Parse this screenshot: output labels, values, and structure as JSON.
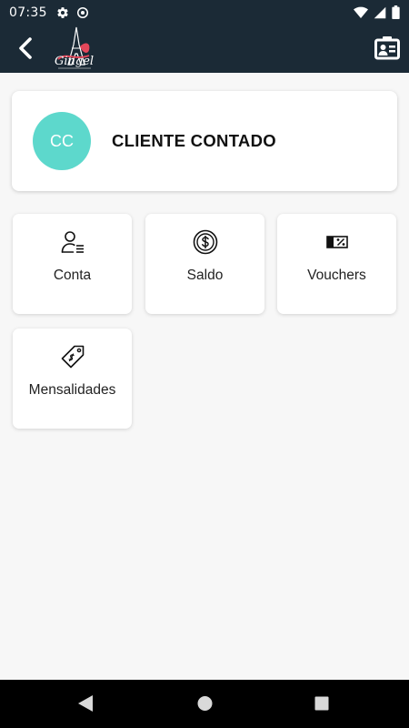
{
  "status_bar": {
    "time": "07:35",
    "left_icons": [
      "settings-icon",
      "sync-icon"
    ],
    "right_icons": [
      "wifi-icon",
      "signal-icon",
      "battery-icon"
    ]
  },
  "app_bar": {
    "back_icon": "chevron-left-icon",
    "logo_text": "Gingel",
    "action_icon": "contact-card-icon",
    "background": "#1b2a36"
  },
  "profile": {
    "initials": "CC",
    "name": "CLIENTE CONTADO",
    "avatar_color": "#5dd8cc"
  },
  "menu": {
    "items": [
      {
        "label": "Conta",
        "icon": "user-list-icon"
      },
      {
        "label": "Saldo",
        "icon": "dollar-coin-icon"
      },
      {
        "label": "Vouchers",
        "icon": "percent-ticket-icon"
      },
      {
        "label": "Mensalidades",
        "icon": "price-tag-icon"
      }
    ]
  },
  "nav_bar": {
    "buttons": [
      "back-triangle-icon",
      "home-circle-icon",
      "recents-square-icon"
    ]
  }
}
